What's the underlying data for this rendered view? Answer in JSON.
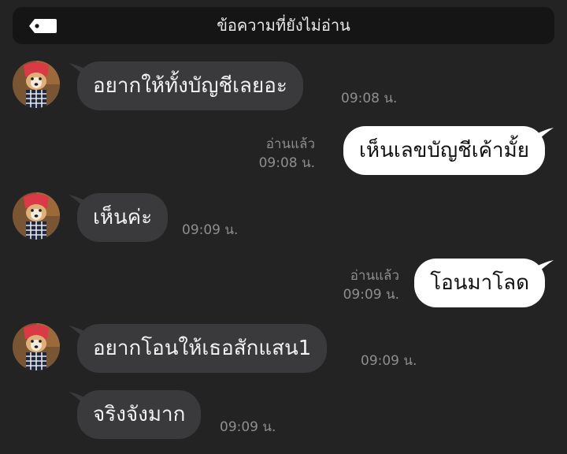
{
  "banner": {
    "icon": "tag-icon",
    "title": "ข้อความที่ยังไม่อ่าน"
  },
  "messages": [
    {
      "direction": "incoming",
      "text": "อยากให้ทั้งบัญชีเลยอะ",
      "time": "09:08 น.",
      "avatar": true
    },
    {
      "direction": "outgoing",
      "text": "เห็นเลขบัญชีเค้ามั้ย",
      "read": "อ่านแล้ว",
      "time": "09:08 น."
    },
    {
      "direction": "incoming",
      "text": "เห็นค่ะ",
      "time": "09:09 น.",
      "avatar": true
    },
    {
      "direction": "outgoing",
      "text": "โอนมาโลด",
      "read": "อ่านแล้ว",
      "time": "09:09 น."
    },
    {
      "direction": "incoming",
      "text": "อยากโอนให้เธอสักแสน1",
      "time": "09:09 น.",
      "avatar": true
    },
    {
      "direction": "incoming",
      "text": "จริงจังมาก",
      "time": "09:09 น.",
      "avatar": false
    }
  ]
}
